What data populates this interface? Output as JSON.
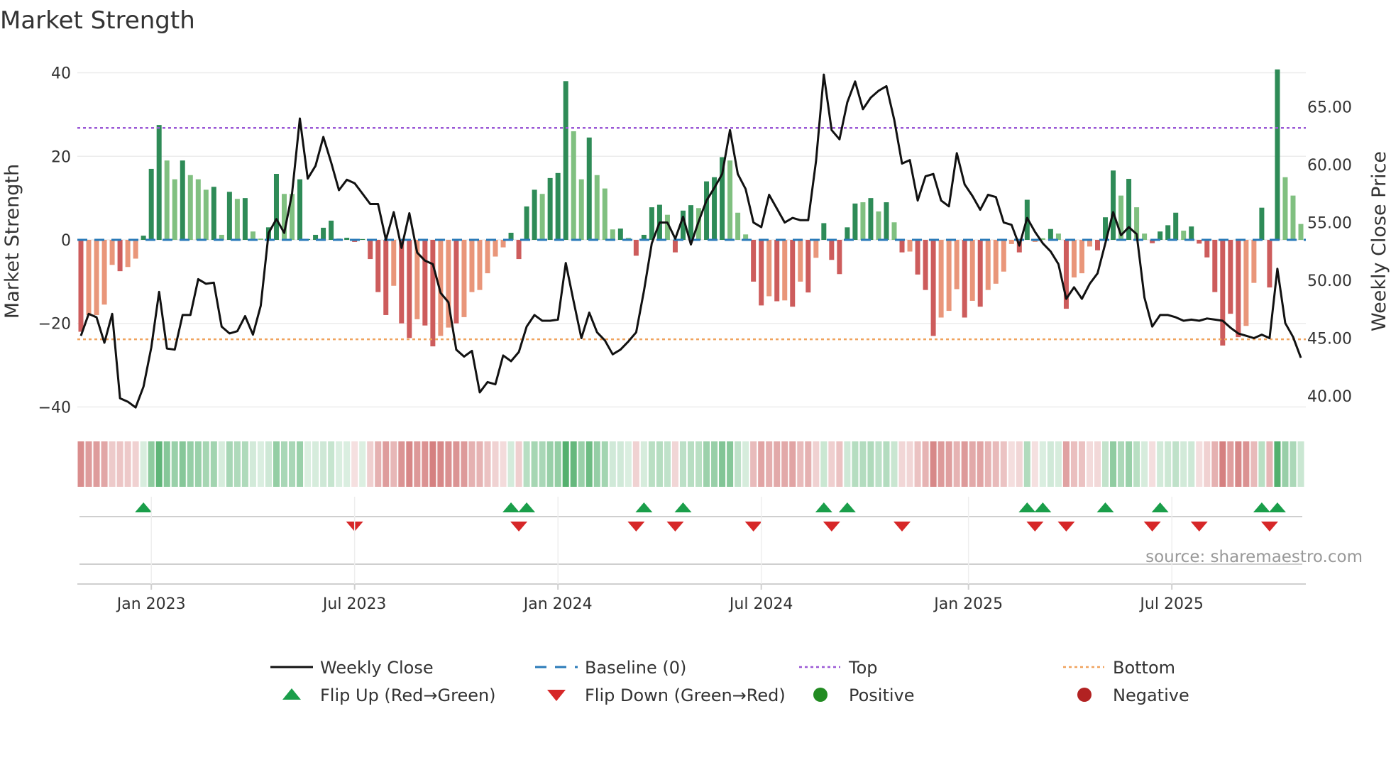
{
  "chart_data": {
    "type": "bar+line",
    "title": "Market Strength",
    "ylabel": "Market Strength",
    "y2label": "Weekly Close Price",
    "ylim": [
      -44,
      44
    ],
    "y2lim": [
      37.6,
      69.4
    ],
    "yticks": [
      {
        "v": 40,
        "label": "40"
      },
      {
        "v": 20,
        "label": "20"
      },
      {
        "v": 0,
        "label": "0"
      },
      {
        "v": -20,
        "label": "−20"
      },
      {
        "v": -40,
        "label": "−40"
      }
    ],
    "y2ticks": [
      {
        "v": 65,
        "label": "65.00"
      },
      {
        "v": 60,
        "label": "60.00"
      },
      {
        "v": 55,
        "label": "55.00"
      },
      {
        "v": 50,
        "label": "50.00"
      },
      {
        "v": 45,
        "label": "45.00"
      },
      {
        "v": 40,
        "label": "40.00"
      }
    ],
    "xticks": [
      {
        "week": 9,
        "label": "Jan 2023"
      },
      {
        "week": 35,
        "label": "Jul 2023"
      },
      {
        "week": 61,
        "label": "Jan 2024"
      },
      {
        "week": 87,
        "label": "Jul 2024"
      },
      {
        "week": 113.5,
        "label": "Jan 2025"
      },
      {
        "week": 139.5,
        "label": "Jul 2025"
      }
    ],
    "top": 26.8,
    "bottom": -23.8,
    "baseline": 0,
    "strength": [
      -22,
      -18,
      -18,
      -15.5,
      -6,
      -7.5,
      -6.5,
      -4.5,
      1,
      17,
      27.5,
      19,
      14.5,
      19,
      15.5,
      14.5,
      12,
      12.7,
      1.2,
      11.5,
      9.8,
      10,
      2,
      0.3,
      3,
      15.8,
      11,
      11,
      14.5,
      0.2,
      1.2,
      2.9,
      4.6,
      0.3,
      0.5,
      -0.5,
      0.2,
      -4.6,
      -12.5,
      -18,
      -11,
      -20,
      -23.5,
      -19,
      -20.5,
      -25.5,
      -23,
      -21,
      -20,
      -18.5,
      -12.5,
      -12,
      -8,
      -4,
      -1.8,
      1.7,
      -4.6,
      8,
      12,
      11,
      14.8,
      16,
      38,
      26,
      14.5,
      24.5,
      15.5,
      12.3,
      2.5,
      2.7,
      0.5,
      -3.8,
      1.2,
      7.8,
      8.4,
      6,
      -3,
      7,
      8.3,
      7.6,
      14,
      15,
      19.8,
      19,
      6.5,
      1.3,
      -10,
      -15.7,
      -13.5,
      -14.7,
      -14.5,
      -16,
      -10,
      -12.6,
      -4.3,
      4,
      -4.8,
      -8.2,
      3,
      8.7,
      9,
      10,
      6.8,
      9,
      4.2,
      -3,
      -2.8,
      -8.3,
      -12,
      -23,
      -18.6,
      -17,
      -11.8,
      -18.6,
      -14.6,
      -16,
      -12,
      -10.5,
      -7.6,
      -1,
      -3,
      9.6,
      -0.5,
      0.4,
      2.6,
      1.5,
      -16.5,
      -9,
      -8,
      -1.6,
      -2.5,
      5.4,
      16.6,
      10.6,
      14.6,
      7.8,
      1.5,
      -0.8,
      2,
      3.5,
      6.5,
      2.2,
      3.2,
      -0.9,
      -4.2,
      -12.5,
      -25.3,
      -17.7,
      -23.3,
      -20.6,
      -10.3,
      7.7,
      -11.4,
      40.8,
      15,
      10.6,
      3.8
    ],
    "strong": [
      1,
      0,
      0,
      0,
      0,
      1,
      0,
      0,
      1,
      1,
      1,
      0,
      0,
      1,
      0,
      0,
      0,
      1,
      0,
      1,
      0,
      1,
      0,
      0,
      1,
      1,
      0,
      0,
      1,
      1,
      1,
      1,
      1,
      1,
      1,
      1,
      1,
      1,
      1,
      1,
      0,
      1,
      1,
      0,
      1,
      1,
      0,
      0,
      1,
      0,
      0,
      0,
      0,
      0,
      0,
      1,
      1,
      1,
      1,
      0,
      1,
      1,
      1,
      0,
      0,
      1,
      0,
      0,
      0,
      1,
      0,
      1,
      1,
      1,
      1,
      0,
      1,
      1,
      1,
      0,
      1,
      1,
      1,
      0,
      0,
      0,
      1,
      1,
      0,
      1,
      0,
      1,
      0,
      1,
      0,
      1,
      1,
      1,
      1,
      1,
      0,
      1,
      0,
      1,
      0,
      1,
      0,
      1,
      1,
      1,
      0,
      0,
      0,
      1,
      0,
      1,
      0,
      0,
      0,
      0,
      1,
      1,
      0,
      0,
      1,
      0,
      1,
      0,
      0,
      0,
      1,
      1,
      1,
      0,
      1,
      0,
      0,
      1,
      1,
      1,
      1,
      0,
      1,
      1,
      1,
      1,
      1,
      1,
      1,
      0,
      0,
      1,
      1,
      1,
      0,
      0,
      0
    ],
    "price": [
      45.2,
      47.1,
      46.8,
      44.6,
      47.1,
      39.8,
      39.5,
      39.0,
      40.8,
      44.2,
      49.0,
      44.1,
      44.0,
      47.0,
      47.0,
      50.1,
      49.7,
      49.8,
      46.0,
      45.4,
      45.6,
      46.9,
      45.3,
      47.8,
      54.1,
      55.3,
      54.1,
      57.5,
      64.0,
      58.8,
      59.9,
      62.4,
      60.2,
      57.8,
      58.7,
      58.4,
      57.5,
      56.6,
      56.6,
      53.5,
      55.9,
      52.8,
      55.8,
      52.4,
      51.7,
      51.4,
      48.9,
      48.1,
      44.0,
      43.4,
      43.9,
      40.3,
      41.2,
      41.0,
      43.5,
      43.0,
      43.8,
      46.0,
      47.0,
      46.5,
      46.5,
      46.6,
      51.5,
      48.2,
      45.0,
      47.2,
      45.5,
      44.8,
      43.6,
      44.0,
      44.7,
      45.5,
      49.1,
      53.2,
      55.0,
      55.0,
      53.6,
      55.5,
      53.1,
      55.1,
      56.9,
      58.0,
      59.2,
      63.0,
      59.2,
      57.9,
      55.0,
      54.6,
      57.4,
      56.2,
      55.0,
      55.4,
      55.2,
      55.2,
      60.3,
      67.8,
      63.0,
      62.2,
      65.4,
      67.2,
      64.8,
      65.8,
      66.4,
      66.8,
      63.9,
      60.1,
      60.4,
      56.9,
      59.0,
      59.2,
      56.9,
      56.4,
      61.0,
      58.3,
      57.3,
      56.1,
      57.4,
      57.2,
      55.0,
      54.8,
      53.0,
      55.4,
      54.2,
      53.2,
      52.5,
      51.4,
      48.4,
      49.4,
      48.4,
      49.7,
      50.6,
      53.2,
      55.9,
      53.9,
      54.6,
      54.0,
      48.5,
      46.0,
      47.0,
      47.0,
      46.8,
      46.5,
      46.6,
      46.5,
      46.7,
      46.6,
      46.5,
      45.9,
      45.4,
      45.2,
      45.0,
      45.3,
      45.0,
      51.0,
      46.3,
      45.1,
      43.3
    ],
    "flips_up": [
      8,
      55,
      57,
      72,
      77,
      95,
      98,
      121,
      123,
      131,
      138,
      151,
      153
    ],
    "flips_down": [
      35,
      56,
      71,
      76,
      86,
      96,
      105,
      122,
      126,
      137,
      143,
      152
    ],
    "colors": {
      "price": "#111111",
      "baseline": "#2b7bb9",
      "top": "#9b59d6",
      "bottom": "#f0a35e",
      "pos_strong": "#2e8b57",
      "pos_weak": "#80c080",
      "neg_strong": "#cd5c5c",
      "neg_weak": "#e9967a",
      "flip_up": "#1a9e4a",
      "flip_down": "#d62728",
      "positive": "#228b22",
      "negative": "#b22222"
    },
    "legend": [
      {
        "label": "Weekly Close",
        "marker": "line"
      },
      {
        "label": "Baseline (0)",
        "marker": "dashed"
      },
      {
        "label": "Top",
        "marker": "dotted-top"
      },
      {
        "label": "Bottom",
        "marker": "dotted-bottom"
      },
      {
        "label": "Flip Up (Red→Green)",
        "marker": "triangle-up"
      },
      {
        "label": "Flip Down (Green→Red)",
        "marker": "triangle-down"
      },
      {
        "label": "Positive",
        "marker": "dot-green"
      },
      {
        "label": "Negative",
        "marker": "dot-red"
      }
    ],
    "legend_position": "bottom",
    "source": "source: sharemaestro.com"
  }
}
